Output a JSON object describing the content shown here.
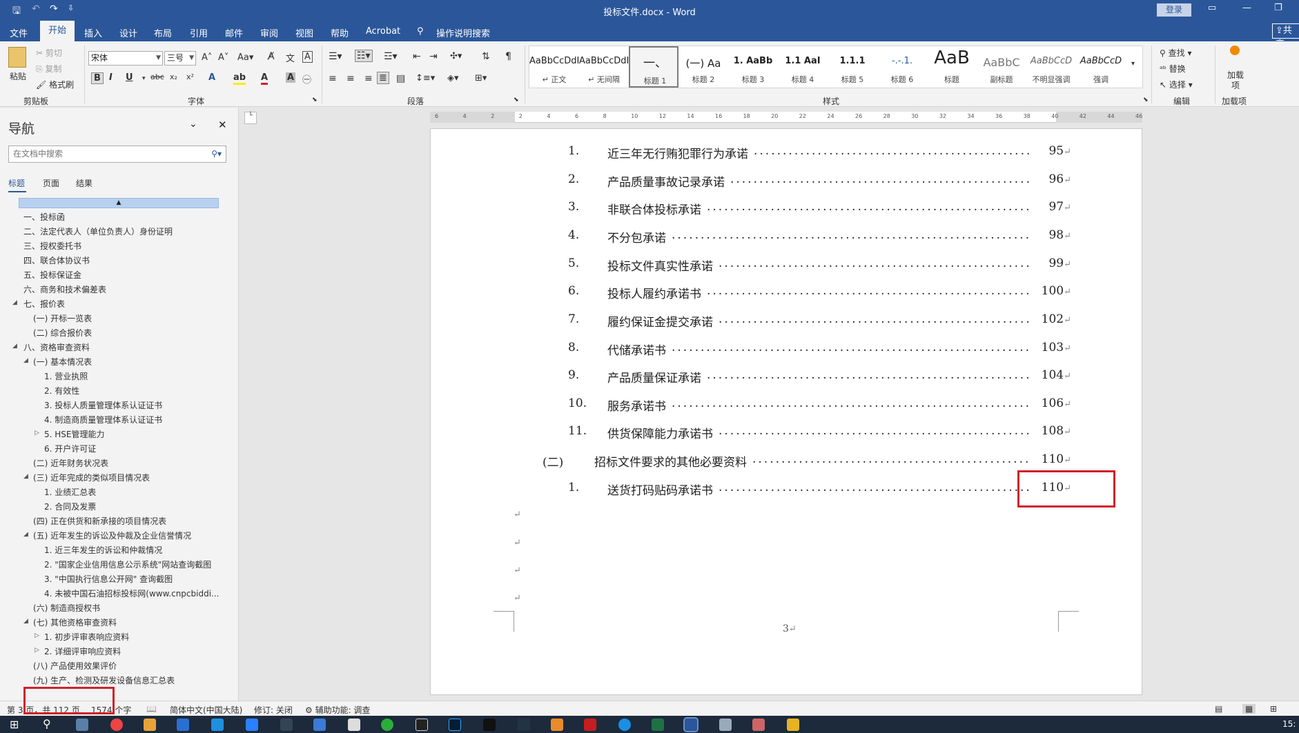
{
  "window": {
    "title": "投标文件.docx  -  Word",
    "login_label": "登录"
  },
  "tabs": [
    {
      "label": "文件"
    },
    {
      "label": "开始"
    },
    {
      "label": "插入"
    },
    {
      "label": "设计"
    },
    {
      "label": "布局"
    },
    {
      "label": "引用"
    },
    {
      "label": "邮件"
    },
    {
      "label": "审阅"
    },
    {
      "label": "视图"
    },
    {
      "label": "帮助"
    },
    {
      "label": "Acrobat"
    },
    {
      "label": "操作说明搜索"
    }
  ],
  "share_label": "共享",
  "ribbon": {
    "clipboard": {
      "paste": "粘贴",
      "cut": "剪切",
      "copy": "复制",
      "painter": "格式刷",
      "label": "剪贴板"
    },
    "font": {
      "name": "宋体",
      "size": "三号",
      "label": "字体"
    },
    "paragraph": {
      "label": "段落"
    },
    "styles": {
      "label": "样式",
      "items": [
        {
          "sample": "AaBbCcDdI",
          "name": "↵ 正文"
        },
        {
          "sample": "AaBbCcDdI",
          "name": "↵ 无间隔"
        },
        {
          "sample": "一、",
          "name": "标题 1"
        },
        {
          "sample": "(一) Aa",
          "name": "标题 2"
        },
        {
          "sample": "1. AaBb",
          "name": "标题 3"
        },
        {
          "sample": "1.1 AaI",
          "name": "标题 4"
        },
        {
          "sample": "1.1.1",
          "name": "标题 5"
        },
        {
          "sample": "-.-.1.",
          "name": "标题 6"
        },
        {
          "sample": "AaB",
          "name": "标题"
        },
        {
          "sample": "AaBbC",
          "name": "副标题"
        },
        {
          "sample": "AaBbCcD",
          "name": "不明显强调"
        },
        {
          "sample": "AaBbCcD",
          "name": "强调"
        }
      ]
    },
    "editing": {
      "find": "查找",
      "replace": "替换",
      "select": "选择",
      "label": "编辑"
    },
    "addins": {
      "button": "加载项",
      "label": "加载项"
    }
  },
  "nav": {
    "title": "导航",
    "search_placeholder": "在文档中搜索",
    "tabs": [
      "标题",
      "页面",
      "结果"
    ],
    "items": [
      {
        "text": "一、投标函"
      },
      {
        "text": "二、法定代表人（单位负责人）身份证明"
      },
      {
        "text": "三、授权委托书"
      },
      {
        "text": "四、联合体协议书"
      },
      {
        "text": "五、投标保证金"
      },
      {
        "text": "六、商务和技术偏差表"
      },
      {
        "text": "七、报价表"
      },
      {
        "text": "(一) 开标一览表"
      },
      {
        "text": "(二) 综合报价表"
      },
      {
        "text": "八、资格审查资料"
      },
      {
        "text": "(一) 基本情况表"
      },
      {
        "text": "1. 营业执照"
      },
      {
        "text": "2. 有效性"
      },
      {
        "text": "3. 投标人质量管理体系认证证书"
      },
      {
        "text": "4. 制造商质量管理体系认证证书"
      },
      {
        "text": "5. HSE管理能力"
      },
      {
        "text": "6. 开户许可证"
      },
      {
        "text": "(二) 近年财务状况表"
      },
      {
        "text": "(三) 近年完成的类似项目情况表"
      },
      {
        "text": "1. 业绩汇总表"
      },
      {
        "text": "2. 合同及发票"
      },
      {
        "text": "(四) 正在供货和新承接的项目情况表"
      },
      {
        "text": "(五) 近年发生的诉讼及仲裁及企业信誉情况"
      },
      {
        "text": "1. 近三年发生的诉讼和仲裁情况"
      },
      {
        "text": "2. \"国家企业信用信息公示系统\"网站查询截图"
      },
      {
        "text": "3. \"中国执行信息公开网\" 查询截图"
      },
      {
        "text": "4. 未被中国石油招标投标网(www.cnpcbiddi..."
      },
      {
        "text": "(六) 制造商授权书"
      },
      {
        "text": "(七) 其他资格审查资料"
      },
      {
        "text": "1. 初步评审表响应资料"
      },
      {
        "text": "2. 详细评审响应资料"
      },
      {
        "text": "(八) 产品使用效果评价"
      },
      {
        "text": "(九) 生产、检测及研发设备信息汇总表"
      }
    ]
  },
  "ruler_ticks": [
    "6",
    "4",
    "2",
    "2",
    "4",
    "6",
    "8",
    "10",
    "12",
    "14",
    "16",
    "18",
    "20",
    "22",
    "24",
    "26",
    "28",
    "30",
    "32",
    "34",
    "36",
    "38",
    "40",
    "42",
    "44",
    "46"
  ],
  "toc": [
    {
      "num": "1.",
      "text": "近三年无行贿犯罪行为承诺",
      "page": "95"
    },
    {
      "num": "2.",
      "text": "产品质量事故记录承诺",
      "page": "96"
    },
    {
      "num": "3.",
      "text": "非联合体投标承诺",
      "page": "97"
    },
    {
      "num": "4.",
      "text": "不分包承诺",
      "page": "98"
    },
    {
      "num": "5.",
      "text": "投标文件真实性承诺",
      "page": "99"
    },
    {
      "num": "6.",
      "text": "投标人履约承诺书",
      "page": "100"
    },
    {
      "num": "7.",
      "text": "履约保证金提交承诺",
      "page": "102"
    },
    {
      "num": "8.",
      "text": "代储承诺书",
      "page": "103"
    },
    {
      "num": "9.",
      "text": "产品质量保证承诺",
      "page": "104"
    },
    {
      "num": "10.",
      "text": "服务承诺书",
      "page": "106"
    },
    {
      "num": "11.",
      "text": "供货保障能力承诺书",
      "page": "108"
    },
    {
      "num": "(二)",
      "text": "招标文件要求的其他必要资料",
      "page": "110"
    },
    {
      "num": "1.",
      "text": "送货打码贴码承诺书",
      "page": "110"
    }
  ],
  "page_footer_number": "3",
  "status": {
    "page": "第 3 页，共 112 页",
    "words": "1574 个字",
    "language": "简体中文(中国大陆)",
    "track": "修订: 关闭",
    "accessibility": "辅助功能: 调查",
    "clock": "15:"
  },
  "colors": {
    "accent": "#2b579a",
    "highlight": "#d0202a"
  }
}
